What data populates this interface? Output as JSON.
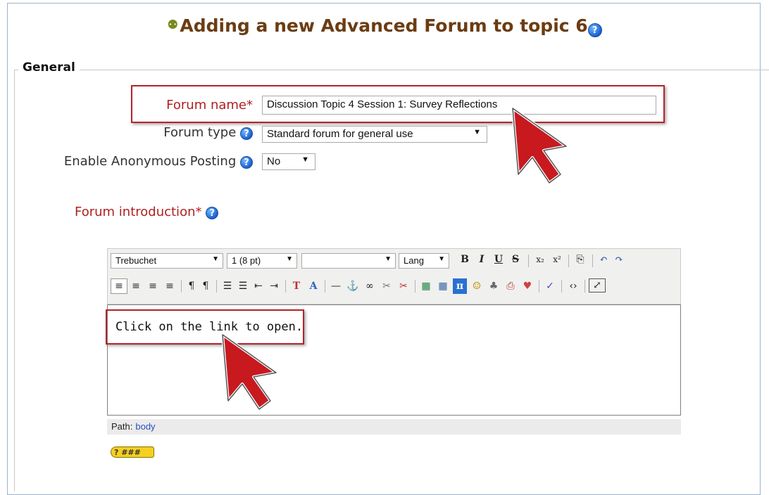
{
  "page": {
    "title": "Adding a new Advanced Forum to topic 6",
    "module_icon": "forum-module-icon",
    "help_icon": "?"
  },
  "fieldset": {
    "legend": "General"
  },
  "fields": {
    "forum_name": {
      "label": "Forum name",
      "required_mark": "*",
      "value": "Discussion Topic 4 Session 1: Survey Reflections"
    },
    "forum_type": {
      "label": "Forum type",
      "value": "Standard forum for general use"
    },
    "anonymous": {
      "label": "Enable Anonymous Posting",
      "value": "No"
    },
    "intro": {
      "label": "Forum introduction",
      "required_mark": "*"
    }
  },
  "editor": {
    "font_family": "Trebuchet",
    "font_size": "1 (8 pt)",
    "format": "",
    "lang": "Lang",
    "content": "Click on the link to open.",
    "path_label": "Path:",
    "path_value": "body",
    "row1_buttons": [
      "B",
      "I",
      "U",
      "S",
      "x₂",
      "x²",
      "⎘",
      "↶",
      "↷"
    ],
    "row2_buttons": [
      "≡",
      "≡",
      "≡",
      "≡",
      "¶",
      "¶",
      "☰",
      "☰",
      "⇤",
      "⇥",
      "T",
      "A",
      "—",
      "⚓",
      "∞",
      "✂",
      "✂",
      "▦",
      "▦",
      "π",
      "☺",
      "♣",
      "⎙",
      "♥",
      "✓",
      "‹›",
      "⤢"
    ],
    "keyboard_help": "? ###"
  },
  "colors": {
    "title": "#6b3c12",
    "required_label": "#b02020",
    "highlight": "#b3242a",
    "help_icon": "#1a5fd0"
  }
}
